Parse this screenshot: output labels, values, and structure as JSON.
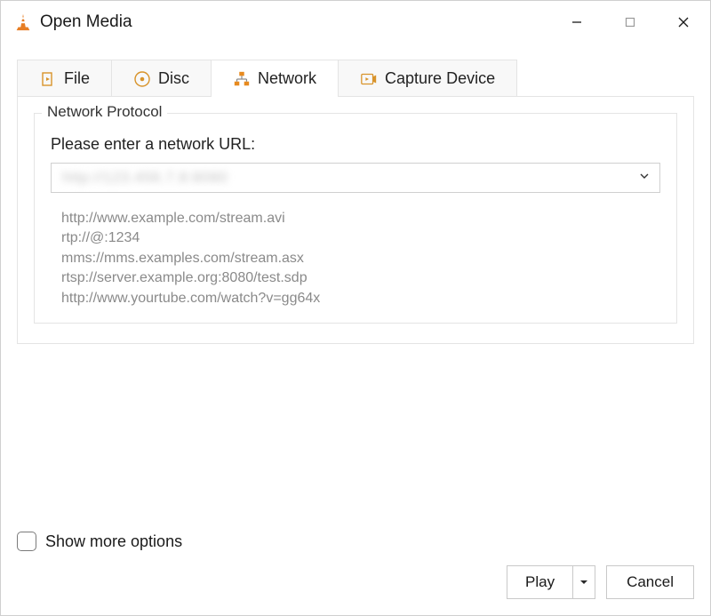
{
  "window": {
    "title": "Open Media"
  },
  "tabs": {
    "file": "File",
    "disc": "Disc",
    "network": "Network",
    "capture": "Capture Device"
  },
  "network_panel": {
    "legend": "Network Protocol",
    "prompt": "Please enter a network URL:",
    "url_value": "http://123.456.7.8:8080",
    "examples": [
      "http://www.example.com/stream.avi",
      "rtp://@:1234",
      "mms://mms.examples.com/stream.asx",
      "rtsp://server.example.org:8080/test.sdp",
      "http://www.yourtube.com/watch?v=gg64x"
    ]
  },
  "footer": {
    "show_more": "Show more options",
    "play": "Play",
    "cancel": "Cancel"
  }
}
